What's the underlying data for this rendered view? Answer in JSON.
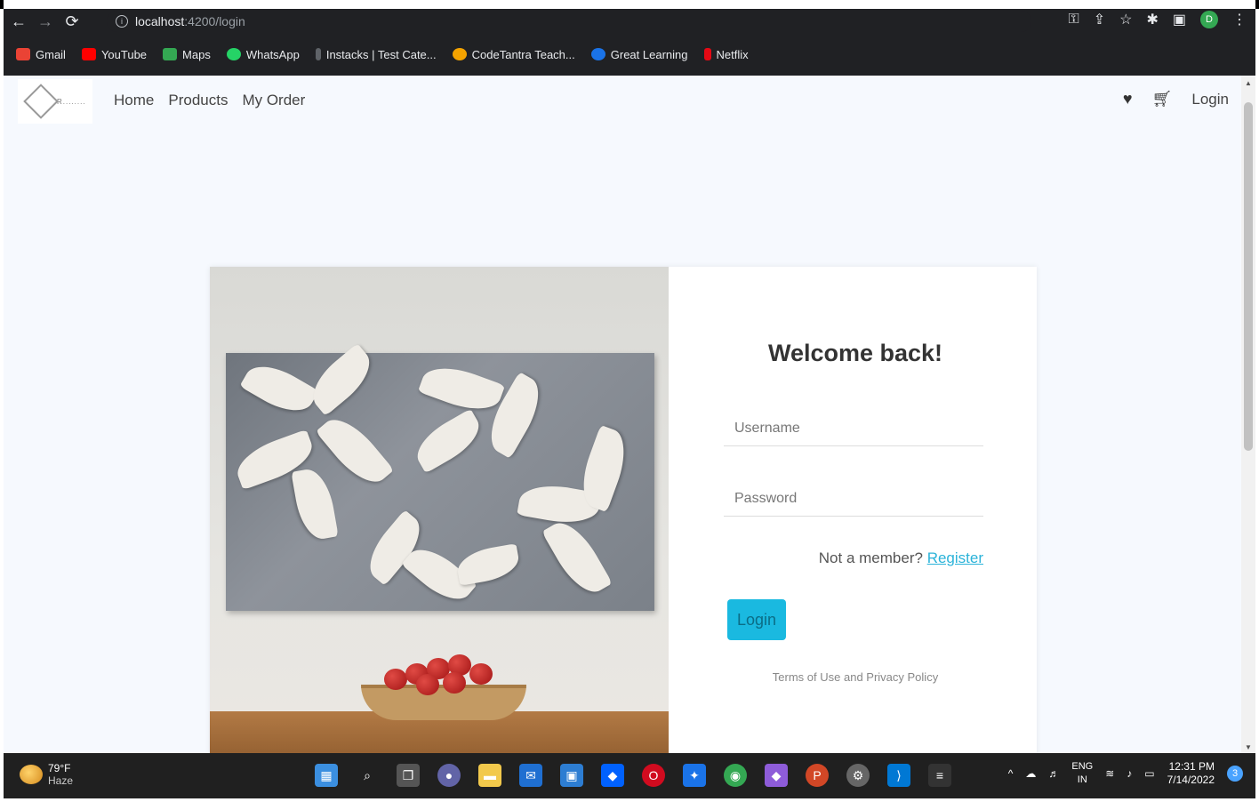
{
  "browser": {
    "url_host": "localhost",
    "url_path": ":4200/login",
    "bookmarks": [
      {
        "label": "Gmail",
        "color": "#ea4335"
      },
      {
        "label": "YouTube",
        "color": "#ff0000"
      },
      {
        "label": "Maps",
        "color": "#34a853"
      },
      {
        "label": "WhatsApp",
        "color": "#25d366"
      },
      {
        "label": "Instacks | Test Cate...",
        "color": "#5f6368"
      },
      {
        "label": "CodeTantra Teach...",
        "color": "#f4a300"
      },
      {
        "label": "Great Learning",
        "color": "#1a73e8"
      },
      {
        "label": "Netflix",
        "color": "#e50914"
      }
    ],
    "profile_initial": "D"
  },
  "navbar": {
    "links": [
      "Home",
      "Products",
      "My Order"
    ],
    "login_label": "Login",
    "logo_text": "R........"
  },
  "login": {
    "title": "Welcome back!",
    "username_placeholder": "Username",
    "password_placeholder": "Password",
    "member_text": "Not a member?",
    "register_label": "Register",
    "login_button": "Login",
    "terms": "Terms of Use and Privacy Policy"
  },
  "taskbar": {
    "temp": "79°F",
    "condition": "Haze",
    "lang_top": "ENG",
    "lang_bottom": "IN",
    "time": "12:31 PM",
    "date": "7/14/2022",
    "notifications": "3"
  },
  "colors": {
    "accent": "#1ab9e0",
    "link": "#2bb3d9"
  }
}
